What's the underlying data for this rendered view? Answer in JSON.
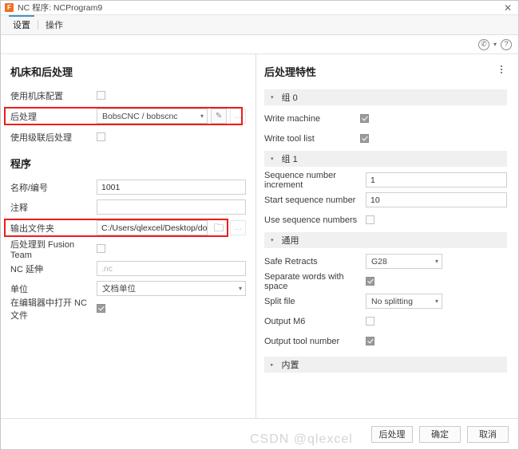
{
  "window": {
    "app_icon_letter": "F",
    "title": "NC 程序: NCProgram9",
    "close_label": "✕"
  },
  "tabs": [
    {
      "label": "设置",
      "active": true
    },
    {
      "label": "操作",
      "active": false
    }
  ],
  "toolbar": {
    "support_icon": "phone-icon",
    "support_glyph": "✆",
    "dropdown_glyph": "▾",
    "help_glyph": "?"
  },
  "left_panel": {
    "section_machine": "机床和后处理",
    "use_machine_config": {
      "label": "使用机床配置",
      "checked": false
    },
    "post_processor": {
      "label": "后处理",
      "value": "BobsCNC / bobscnc",
      "edit_glyph": "✎",
      "more_glyph": "…",
      "highlighted": true
    },
    "use_cascading_post": {
      "label": "使用级联后处理",
      "checked": false
    },
    "section_program": "程序",
    "name_number": {
      "label": "名称/编号",
      "value": "1001"
    },
    "comment": {
      "label": "注释",
      "value": ""
    },
    "output_folder": {
      "label": "输出文件夹",
      "value": "C:/Users/qlexcel/Desktop/doc",
      "folder_glyph": "🗀",
      "more_glyph": "…",
      "highlighted": true
    },
    "post_to_fusion_team": {
      "label": "后处理到 Fusion Team",
      "checked": false
    },
    "nc_extension": {
      "label": "NC 延伸",
      "placeholder": ".nc",
      "value": ""
    },
    "unit": {
      "label": "单位",
      "value": "文档单位"
    },
    "open_nc_in_editor": {
      "label": "在编辑器中打开 NC 文件",
      "checked": true
    }
  },
  "right_panel": {
    "title": "后处理特性",
    "menu_icon": "more-vertical-icon",
    "groups": [
      {
        "name": "组 0",
        "expanded": true,
        "expand_glyph": "▾",
        "rows": [
          {
            "type": "checkbox",
            "label": "Write machine",
            "checked": true
          },
          {
            "type": "checkbox",
            "label": "Write tool list",
            "checked": true
          }
        ]
      },
      {
        "name": "组 1",
        "expanded": true,
        "expand_glyph": "▾",
        "rows": [
          {
            "type": "text",
            "label": "Sequence number increment",
            "value": "1"
          },
          {
            "type": "text",
            "label": "Start sequence number",
            "value": "10"
          },
          {
            "type": "checkbox",
            "label": "Use sequence numbers",
            "checked": false
          }
        ]
      },
      {
        "name": "通用",
        "expanded": true,
        "expand_glyph": "▾",
        "rows": [
          {
            "type": "combo",
            "label": "Safe Retracts",
            "value": "G28"
          },
          {
            "type": "checkbox",
            "label": "Separate words with space",
            "checked": true
          },
          {
            "type": "combo",
            "label": "Split file",
            "value": "No splitting"
          },
          {
            "type": "checkbox",
            "label": "Output M6",
            "checked": false
          },
          {
            "type": "checkbox",
            "label": "Output tool number",
            "checked": true
          }
        ]
      },
      {
        "name": "内置",
        "expanded": false,
        "expand_glyph": "▸",
        "rows": []
      }
    ]
  },
  "footer": {
    "post_process": "后处理",
    "ok": "确定",
    "cancel": "取消",
    "watermark": "CSDN @qlexcel"
  },
  "colors": {
    "accent": "#4a90c4",
    "highlight": "#ee1c1c",
    "app_icon": "#f07020",
    "group_header_bg": "#f0f0f0"
  }
}
